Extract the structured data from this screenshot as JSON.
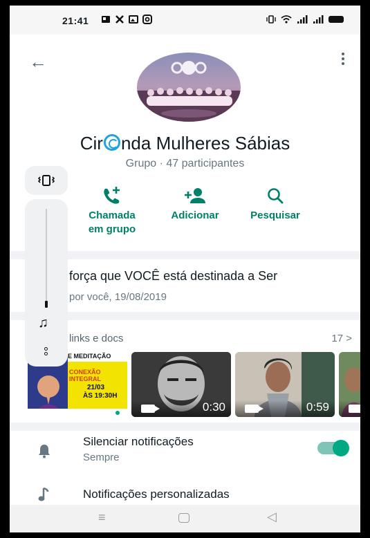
{
  "status_bar": {
    "time": "21:41",
    "left_icons": [
      "sim-card-icon",
      "tools-icon",
      "gallery-icon",
      "instagram-icon"
    ],
    "right_icons": [
      "vibrate-icon",
      "wifi-icon",
      "signal-icon",
      "signal-icon",
      "battery-icon"
    ]
  },
  "header": {
    "group_name_before": "Cir",
    "group_name_after": "nda Mulheres Sábias",
    "subtitle": "Grupo · 47 participantes"
  },
  "actions": [
    {
      "icon": "call-add-icon",
      "line1": "Chamada",
      "line2": "em grupo"
    },
    {
      "icon": "person-add-icon",
      "line1": "Adicionar",
      "line2": ""
    },
    {
      "icon": "search-icon",
      "line1": "Pesquisar",
      "line2": ""
    }
  ],
  "description": {
    "text": "força que VOCÊ está destinada a Ser",
    "meta": "por você, 19/08/2019"
  },
  "media": {
    "title": "links e docs",
    "count": "17 >",
    "items": [
      {
        "type": "image",
        "banner": "E MEDITAÇÃO",
        "subtitle": "CONEXÃO INTEGRAL",
        "date": "21/03",
        "time": "ÀS 19:30H"
      },
      {
        "type": "video",
        "duration": "0:30"
      },
      {
        "type": "video",
        "duration": "0:59"
      },
      {
        "type": "video",
        "duration": ""
      }
    ]
  },
  "settings": {
    "mute_title": "Silenciar notificações",
    "mute_sub": "Sempre",
    "mute_enabled": true,
    "custom_title": "Notificações personalizadas"
  },
  "colors": {
    "accent": "#008069",
    "toggle": "#00a884",
    "separator": "#f0f2f5"
  }
}
